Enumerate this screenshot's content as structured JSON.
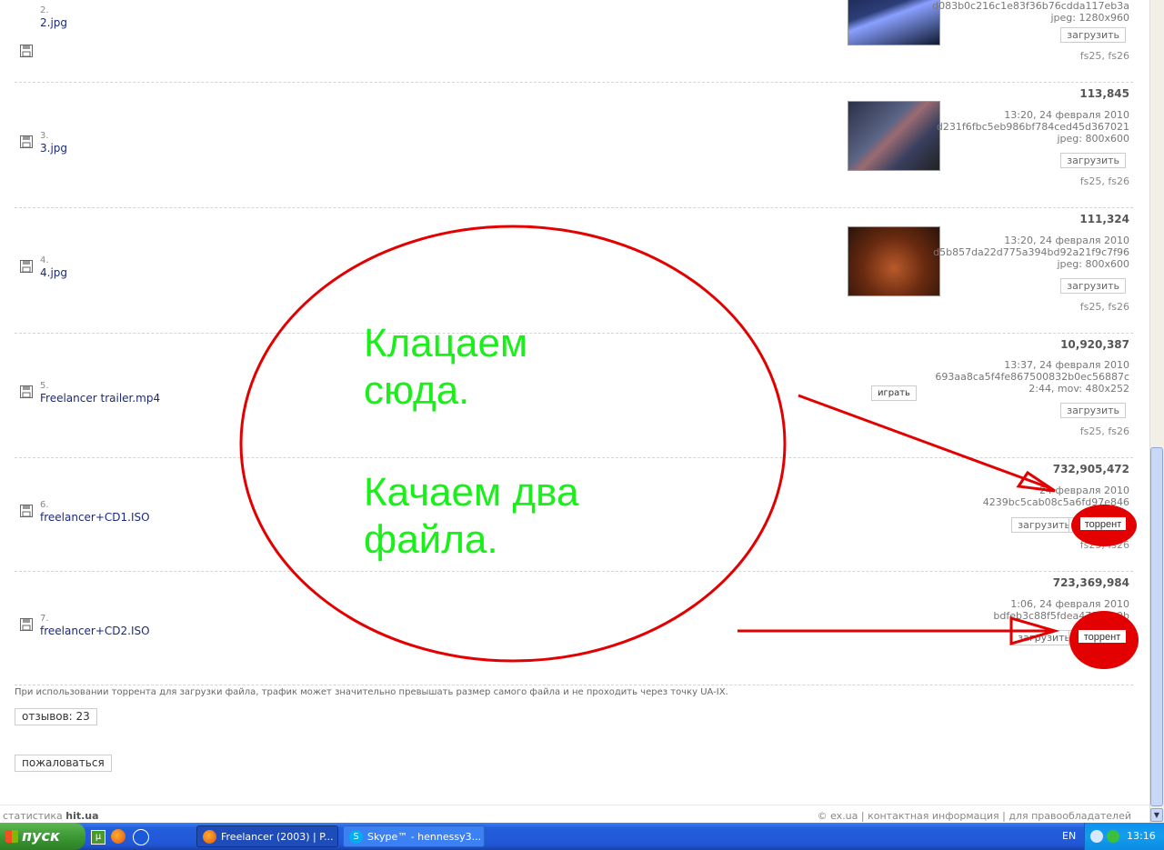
{
  "files": [
    {
      "num": "2.",
      "name": "2.jpg",
      "size": "",
      "meta": [
        "d083b0c216c1e83f36b76cdda117eb3a",
        "jpeg: 1280x960"
      ],
      "tags": "fs25, fs26",
      "download": "загрузить"
    },
    {
      "num": "3.",
      "name": "3.jpg",
      "size": "113,845",
      "meta": [
        "13:20, 24 февраля 2010",
        "d231f6fbc5eb986bf784ced45d367021",
        "jpeg: 800x600"
      ],
      "tags": "fs25, fs26",
      "download": "загрузить"
    },
    {
      "num": "4.",
      "name": "4.jpg",
      "size": "111,324",
      "meta": [
        "13:20, 24 февраля 2010",
        "d5b857da22d775a394bd92a21f9c7f96",
        "jpeg: 800x600"
      ],
      "tags": "fs25, fs26",
      "download": "загрузить"
    },
    {
      "num": "5.",
      "name": "Freelancer trailer.mp4",
      "size": "10,920,387",
      "meta": [
        "13:37, 24 февраля 2010",
        "693aa8ca5f4fe867500832b0ec56887c",
        "2:44, mov: 480x252"
      ],
      "tags": "fs25, fs26",
      "download": "загрузить",
      "play": "играть"
    },
    {
      "num": "6.",
      "name": "freelancer+CD1.ISO",
      "size": "732,905,472",
      "meta": [
        "24 февраля 2010",
        "4239bc5cab08c5a6fd97e846"
      ],
      "tags": "fs25, fs26",
      "download": "загрузить",
      "torrent": "торрент"
    },
    {
      "num": "7.",
      "name": "freelancer+CD2.ISO",
      "size": "723,369,984",
      "meta": [
        "1:06, 24 февраля 2010",
        "bdfeb3c88f5fdea47135a0b"
      ],
      "tags": "fs25, fs2",
      "download": "загрузить",
      "torrent": "торрент"
    }
  ],
  "notice": "При использовании торрента для загрузки файла, трафик может значительно превышать размер самого файла и не проходить через точку UA-IX.",
  "reviews_button": "отзывов: 23",
  "complain_button": "пожаловаться",
  "footer": {
    "stats_prefix": "статистика",
    "stats_brand": "hit.ua",
    "right": "© ex.ua | контактная информация | для правообладателей"
  },
  "annotation": {
    "line1": "Клацаем",
    "line2": "сюда.",
    "line3": "Качаем два",
    "line4": "файла."
  },
  "taskbar": {
    "start": "пуск",
    "tasks": [
      "Freelancer (2003) | P...",
      "Skype™ - hennessy3..."
    ],
    "lang": "EN",
    "clock": "13:16"
  },
  "colors": {
    "annotation_red": "#e30000",
    "annotation_green": "#19ef19",
    "link_blue": "#1a2a7a"
  }
}
